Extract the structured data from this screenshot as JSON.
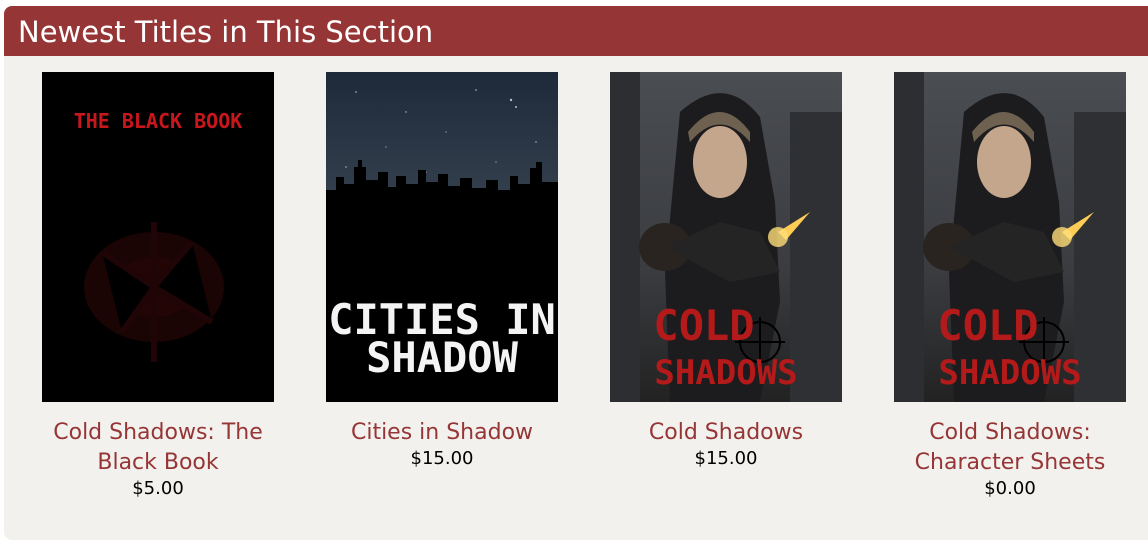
{
  "section": {
    "title": "Newest Titles in This Section"
  },
  "products": [
    {
      "title": "Cold Shadows: The Black Book",
      "price": "$5.00",
      "cover_text": "THE BLACK BOOK",
      "cover_icon": "red-splatter-icon"
    },
    {
      "title": "Cities in Shadow",
      "price": "$15.00",
      "cover_text_line1": "CITIES IN",
      "cover_text_line2": "SHADOW",
      "cover_icon": "city-skyline-icon"
    },
    {
      "title": "Cold Shadows",
      "price": "$15.00",
      "cover_text_line1": "COLD",
      "cover_text_line2": "SHADOWS",
      "cover_icon": "hooded-figure-icon"
    },
    {
      "title": "Cold Shadows: Character Sheets",
      "price": "$0.00",
      "cover_text_line1": "COLD",
      "cover_text_line2": "SHADOWS",
      "cover_icon": "hooded-figure-icon"
    }
  ],
  "colors": {
    "header_bg": "#963535",
    "title_link": "#963535",
    "panel_bg": "#f2f1ee"
  }
}
